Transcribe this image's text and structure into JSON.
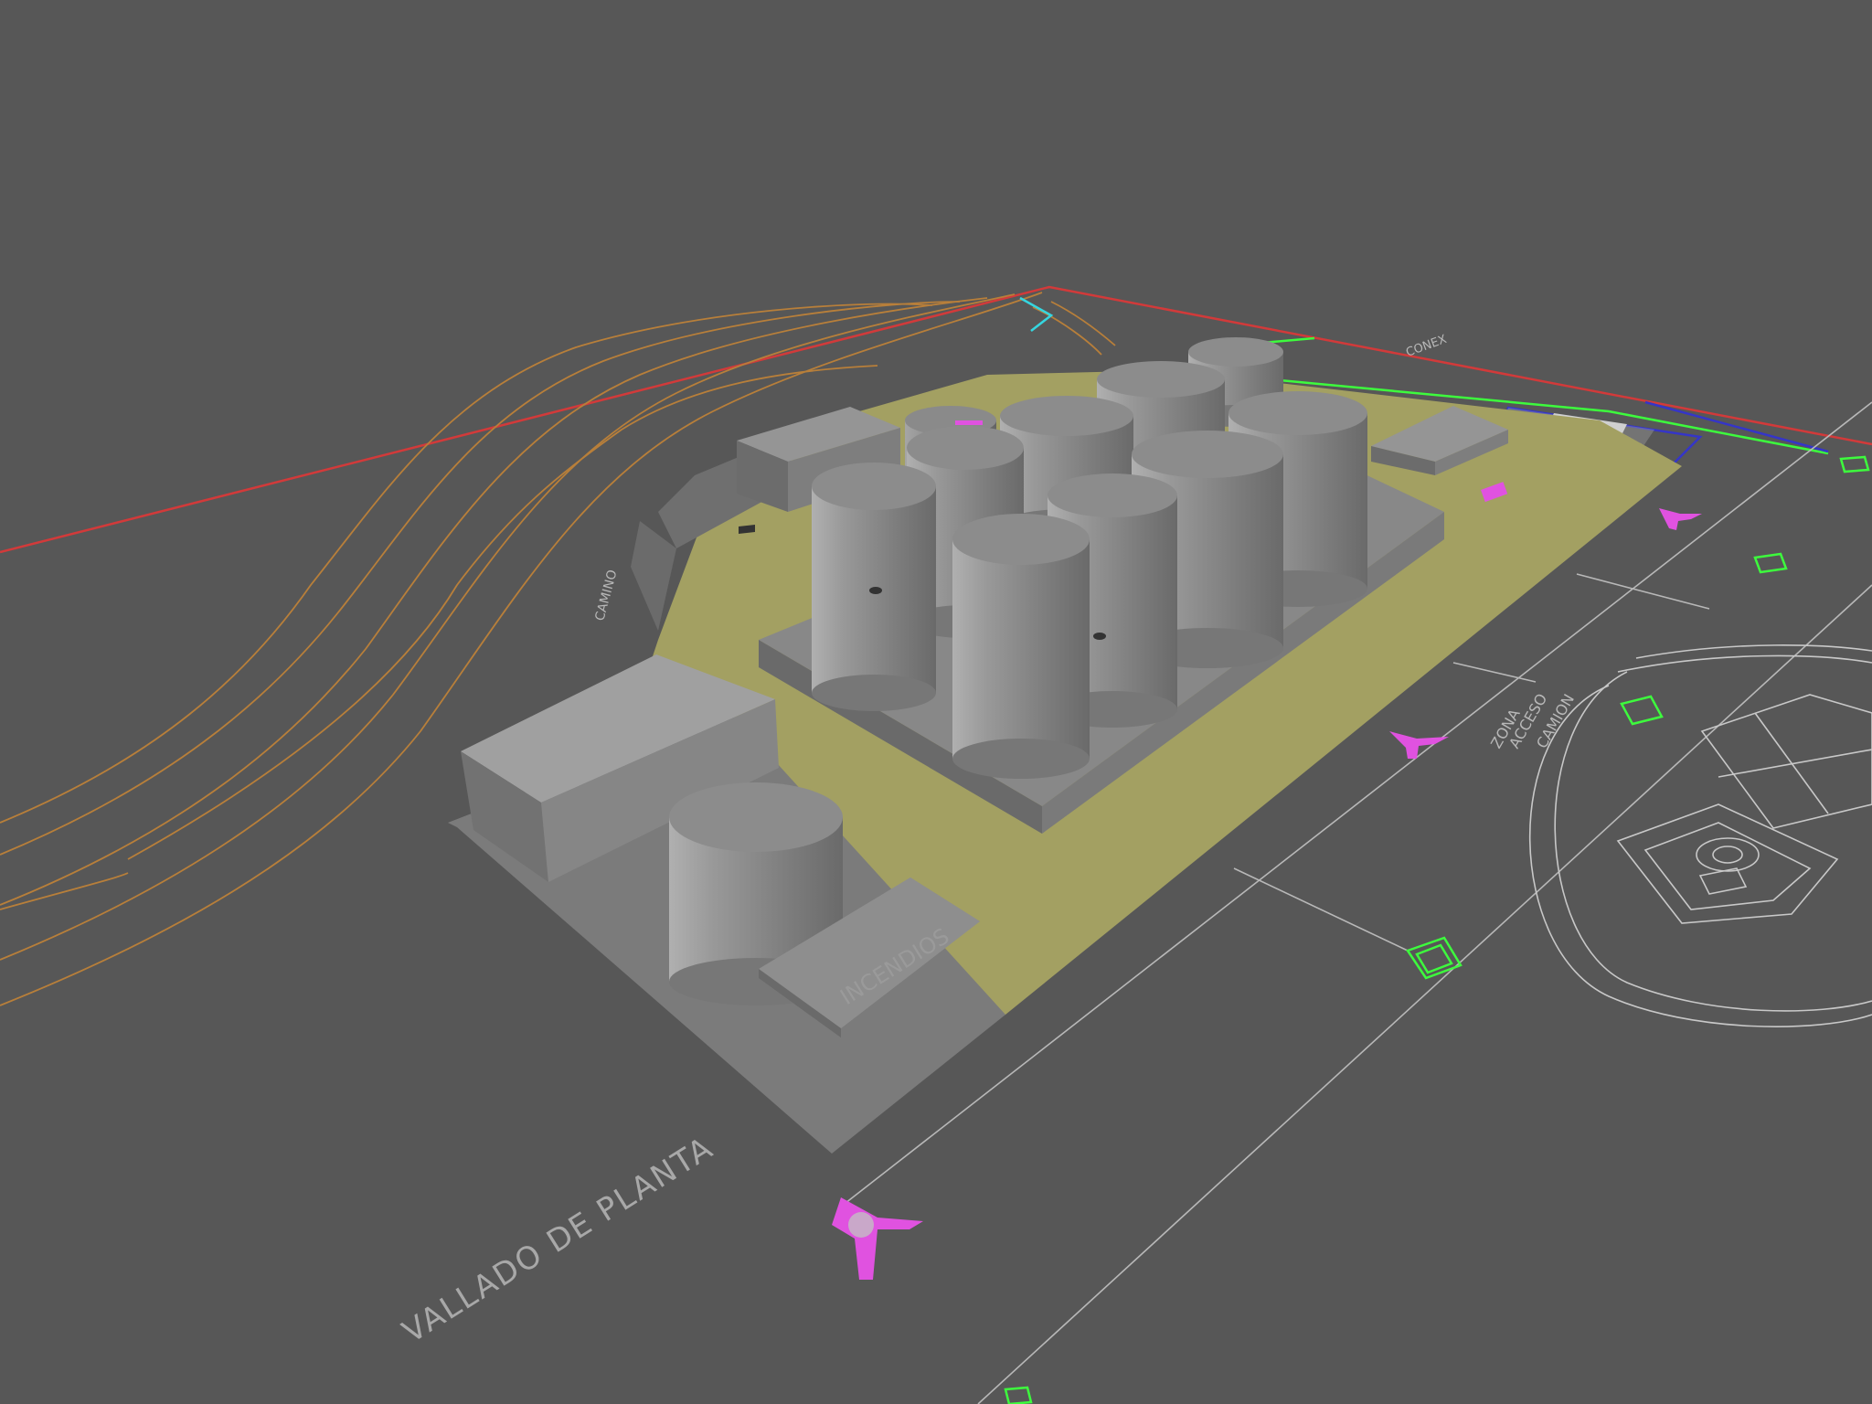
{
  "viewport": {
    "background": "#575757"
  },
  "labels": {
    "fence": "VALLADO DE PLANTA",
    "fire_block": "INCENDIOS"
  },
  "colors": {
    "boundary": "#d23a3a",
    "contour": "#b87f3a",
    "pad": "#a3a062",
    "tank": "#8a8a8a",
    "building": "#7d7d7d",
    "cad_line": "#b8b8b8",
    "marker_green": "#3dfb3d",
    "marker_magenta": "#e052e0",
    "cad_blue": "#3535c8",
    "cad_cyan": "#35d6e0"
  },
  "icons": {
    "equipment_markers": "equipment-marker-icon",
    "hydrant_markers": "hydrant-symbol-icon"
  }
}
